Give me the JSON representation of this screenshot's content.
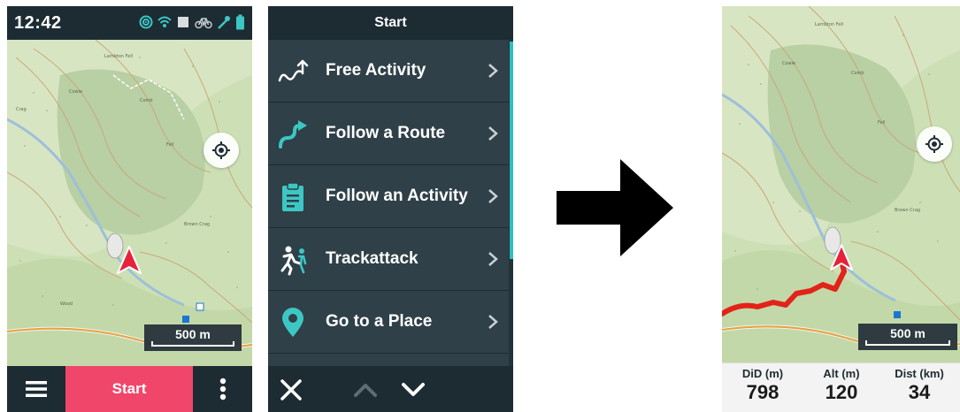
{
  "screen1": {
    "status": {
      "time": "12:42"
    },
    "scale": "500 m",
    "bottombar": {
      "start_label": "Start"
    }
  },
  "screen2": {
    "title": "Start",
    "menu": [
      {
        "label": "Free Activity",
        "icon": "free-activity-icon"
      },
      {
        "label": "Follow a Route",
        "icon": "route-icon"
      },
      {
        "label": "Follow an Activity",
        "icon": "clipboard-icon"
      },
      {
        "label": "Trackattack",
        "icon": "trackattack-icon"
      },
      {
        "label": "Go to a Place",
        "icon": "location-pin-icon"
      }
    ]
  },
  "screen3": {
    "scale": "500 m",
    "fields": [
      {
        "label": "DiD (m)",
        "value": "798"
      },
      {
        "label": "Alt (m)",
        "value": "120"
      },
      {
        "label": "Dist (km)",
        "value": "34"
      }
    ]
  },
  "colors": {
    "accent": "#f0466a",
    "teal": "#2dbfc0",
    "dark_bar": "#1d2b33",
    "menu_bg": "#2f4048",
    "track": "#e2231a"
  }
}
